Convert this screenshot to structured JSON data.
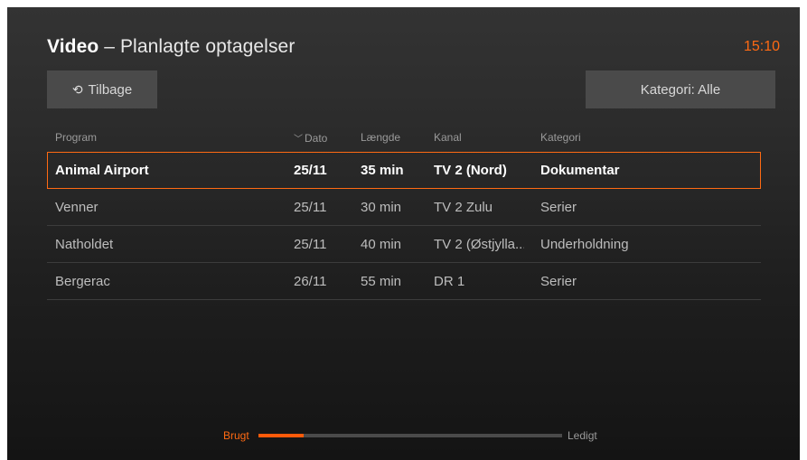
{
  "header": {
    "title_bold": "Video",
    "title_rest": " – Planlagte optagelser",
    "clock": "15:10"
  },
  "buttons": {
    "back_label": "Tilbage",
    "category_label": "Kategori: Alle"
  },
  "table": {
    "columns": {
      "program": "Program",
      "date": "Dato",
      "length": "Længde",
      "channel": "Kanal",
      "category": "Kategori"
    },
    "sort_icon": "chevron-down-icon",
    "rows": [
      {
        "program": "Animal Airport",
        "date": "25/11",
        "length": "35 min",
        "channel": "TV 2 (Nord)",
        "category": "Dokumentar"
      },
      {
        "program": "Venner",
        "date": "25/11",
        "length": "30 min",
        "channel": "TV 2 Zulu",
        "category": "Serier"
      },
      {
        "program": "Natholdet",
        "date": "25/11",
        "length": "40 min",
        "channel": "TV 2 (Østjylla...",
        "category": "Underholdning"
      },
      {
        "program": "Bergerac",
        "date": "26/11",
        "length": "55 min",
        "channel": "DR 1",
        "category": "Serier"
      }
    ],
    "selected_index": 0
  },
  "storage": {
    "used_label": "Brugt",
    "free_label": "Ledigt",
    "used_fraction": 0.15
  },
  "colors": {
    "accent": "#ff6a13",
    "button_bg": "#4a4a4a"
  }
}
